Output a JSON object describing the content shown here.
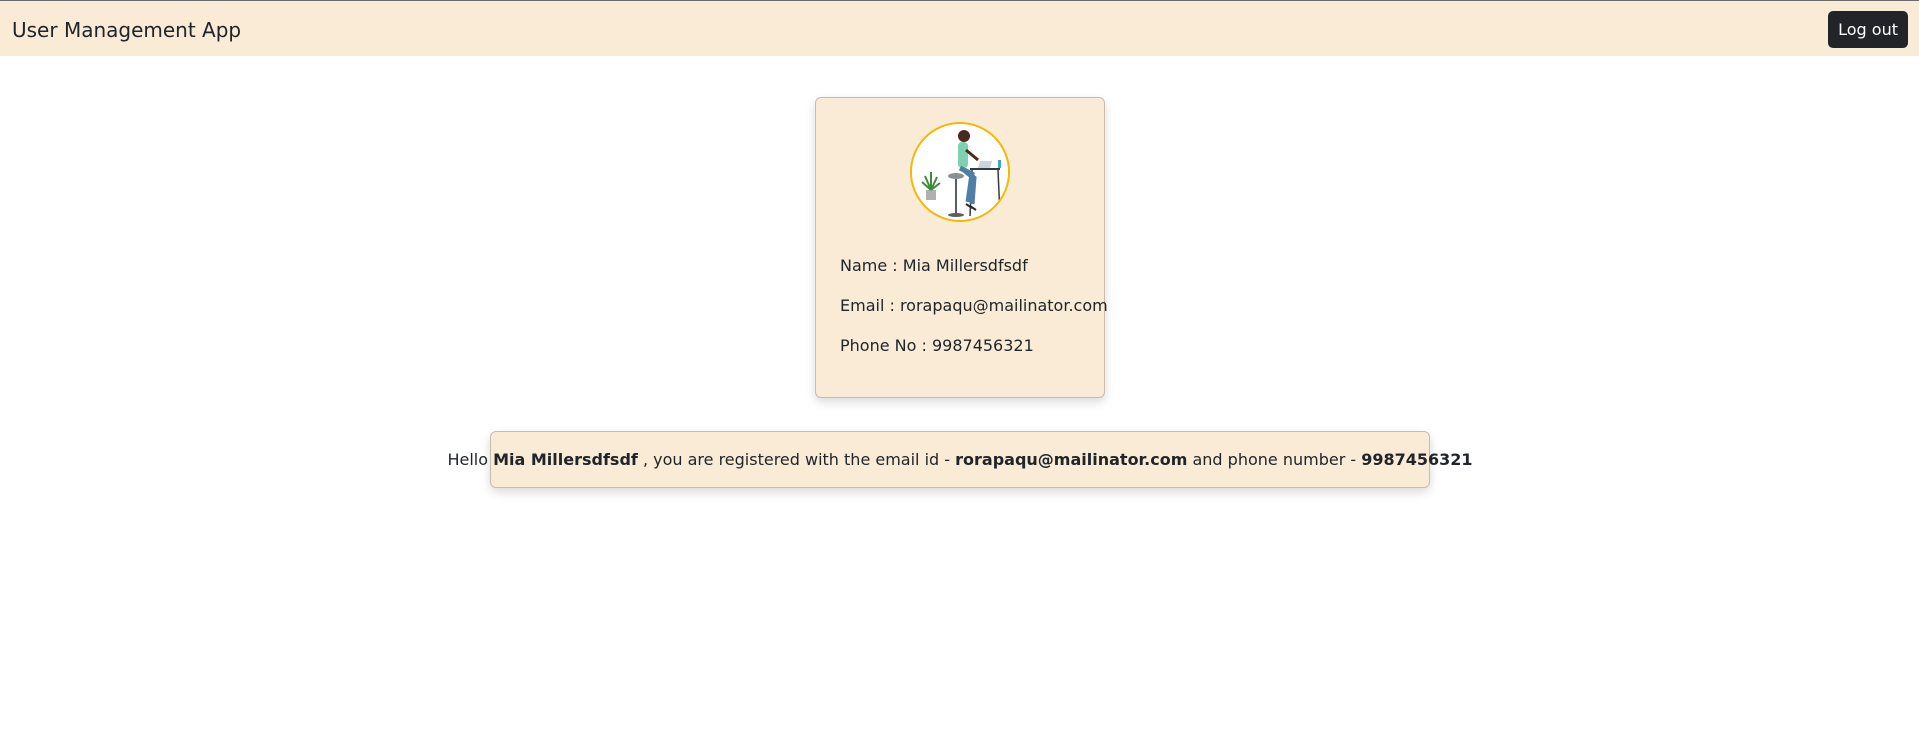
{
  "navbar": {
    "brand": "User Management App",
    "logout_label": "Log out"
  },
  "profile": {
    "avatar_icon": "person-at-desk-illustration",
    "name_label": "Name : ",
    "name": "Mia Millersdfsdf",
    "email_label": "Email : ",
    "email": "rorapaqu@mailinator.com",
    "phone_label": "Phone No : ",
    "phone": "9987456321"
  },
  "greeting": {
    "hello": "Hello ",
    "name": "Mia Millersdfsdf",
    "registered_text": " , you are registered with the email id - ",
    "email": "rorapaqu@mailinator.com",
    "phone_text": " and phone number - ",
    "phone": "9987456321"
  },
  "colors": {
    "panel_bg": "#faebd7",
    "button_bg": "#212529",
    "avatar_border": "#f5b800"
  }
}
